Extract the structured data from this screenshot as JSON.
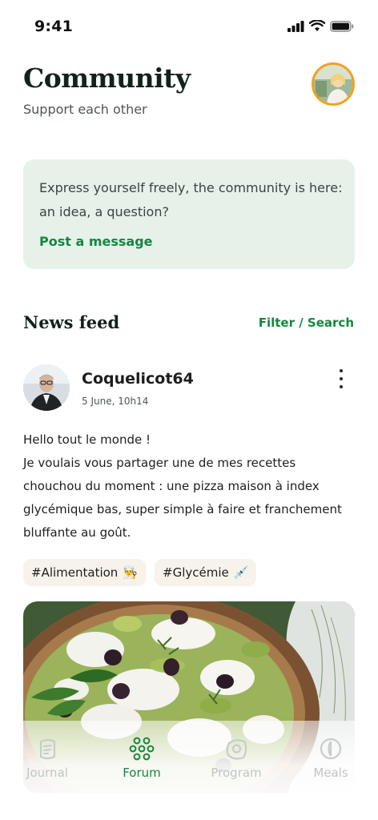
{
  "status_bar": {
    "time": "9:41"
  },
  "header": {
    "title": "Community",
    "subtitle": "Support each other"
  },
  "compose": {
    "prompt": "Express yourself freely, the community is here: an idea, a question?",
    "action_label": "Post a message"
  },
  "feed": {
    "title": "News feed",
    "filter_label": "Filter / Search"
  },
  "post": {
    "author": "Coquelicot64",
    "date": "5 June, 10h14",
    "body_lines": [
      "Hello tout le monde !",
      "Je voulais vous partager une de mes recettes",
      "chouchou du moment : une pizza maison à index",
      "glycémique bas, super simple à faire et franchement",
      "bluffante au goût."
    ],
    "tags": [
      {
        "label": "#Alimentation",
        "emoji": "👨‍🍳"
      },
      {
        "label": "#Glycémie",
        "emoji": "💉"
      }
    ]
  },
  "tabs": [
    {
      "label": "Journal",
      "icon": "journal-icon",
      "active": false
    },
    {
      "label": "Forum",
      "icon": "forum-icon",
      "active": true
    },
    {
      "label": "Program",
      "icon": "program-icon",
      "active": false
    },
    {
      "label": "Meals",
      "icon": "meals-icon",
      "active": false
    }
  ],
  "colors": {
    "accent": "#13883f",
    "card_bg": "#e6f1ea",
    "avatar_ring": "#f0a21f",
    "tag_bg": "#f7f2ea",
    "inactive_tab": "#c0c6c3"
  }
}
